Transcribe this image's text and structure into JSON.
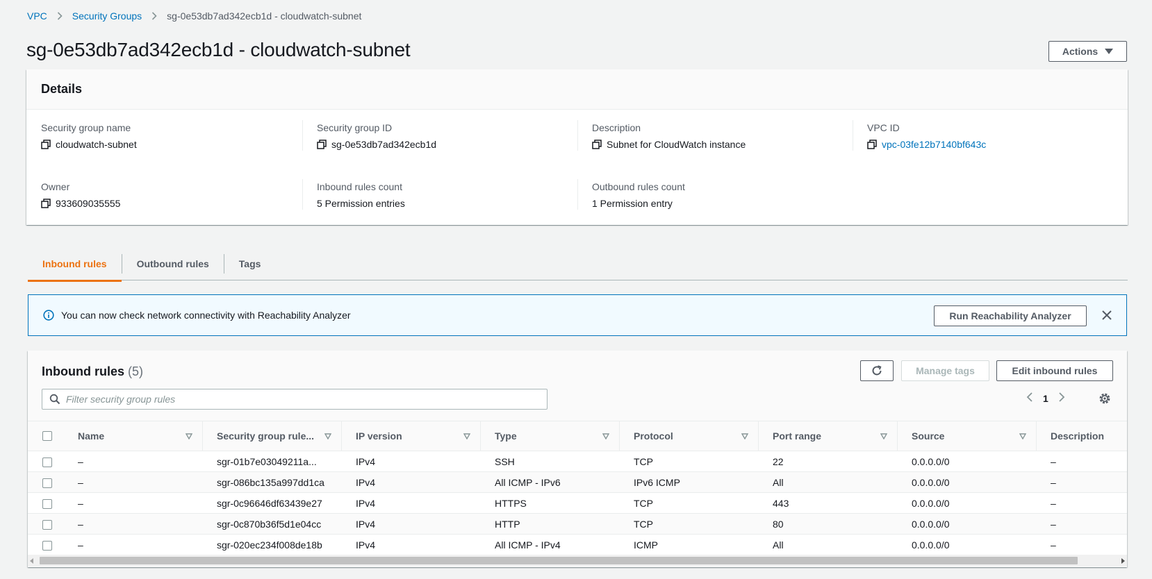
{
  "breadcrumb": {
    "items": [
      "VPC",
      "Security Groups"
    ],
    "current": "sg-0e53db7ad342ecb1d - cloudwatch-subnet"
  },
  "page_title": "sg-0e53db7ad342ecb1d - cloudwatch-subnet",
  "actions_label": "Actions",
  "details": {
    "title": "Details",
    "fields": [
      {
        "label": "Security group name",
        "value": "cloudwatch-subnet",
        "copy": true,
        "link": false
      },
      {
        "label": "Security group ID",
        "value": "sg-0e53db7ad342ecb1d",
        "copy": true,
        "link": false
      },
      {
        "label": "Description",
        "value": "Subnet for CloudWatch instance",
        "copy": true,
        "link": false
      },
      {
        "label": "VPC ID",
        "value": "vpc-03fe12b7140bf643c",
        "copy": true,
        "link": true
      },
      {
        "label": "Owner",
        "value": "933609035555",
        "copy": true,
        "link": false
      },
      {
        "label": "Inbound rules count",
        "value": "5 Permission entries",
        "copy": false,
        "link": false
      },
      {
        "label": "Outbound rules count",
        "value": "1 Permission entry",
        "copy": false,
        "link": false
      }
    ]
  },
  "tabs": [
    {
      "label": "Inbound rules",
      "active": true
    },
    {
      "label": "Outbound rules",
      "active": false
    },
    {
      "label": "Tags",
      "active": false
    }
  ],
  "flash": {
    "text": "You can now check network connectivity with Reachability Analyzer",
    "button": "Run Reachability Analyzer"
  },
  "rules": {
    "title": "Inbound rules",
    "count": "(5)",
    "manage_tags": "Manage tags",
    "edit": "Edit inbound rules",
    "filter_placeholder": "Filter security group rules",
    "page": "1",
    "columns": [
      "Name",
      "Security group rule...",
      "IP version",
      "Type",
      "Protocol",
      "Port range",
      "Source",
      "Description"
    ],
    "rows": [
      [
        "–",
        "sgr-01b7e03049211a...",
        "IPv4",
        "SSH",
        "TCP",
        "22",
        "0.0.0.0/0",
        "–"
      ],
      [
        "–",
        "sgr-086bc135a997dd1ca",
        "IPv4",
        "All ICMP - IPv6",
        "IPv6 ICMP",
        "All",
        "0.0.0.0/0",
        "–"
      ],
      [
        "–",
        "sgr-0c96646df63439e27",
        "IPv4",
        "HTTPS",
        "TCP",
        "443",
        "0.0.0.0/0",
        "–"
      ],
      [
        "–",
        "sgr-0c870b36f5d1e04cc",
        "IPv4",
        "HTTP",
        "TCP",
        "80",
        "0.0.0.0/0",
        "–"
      ],
      [
        "–",
        "sgr-020ec234f008de18b",
        "IPv4",
        "All ICMP - IPv4",
        "ICMP",
        "All",
        "0.0.0.0/0",
        "–"
      ]
    ]
  },
  "colors": {
    "link": "#0073bb",
    "accent": "#ec7211",
    "info_bg": "#f1faff"
  }
}
